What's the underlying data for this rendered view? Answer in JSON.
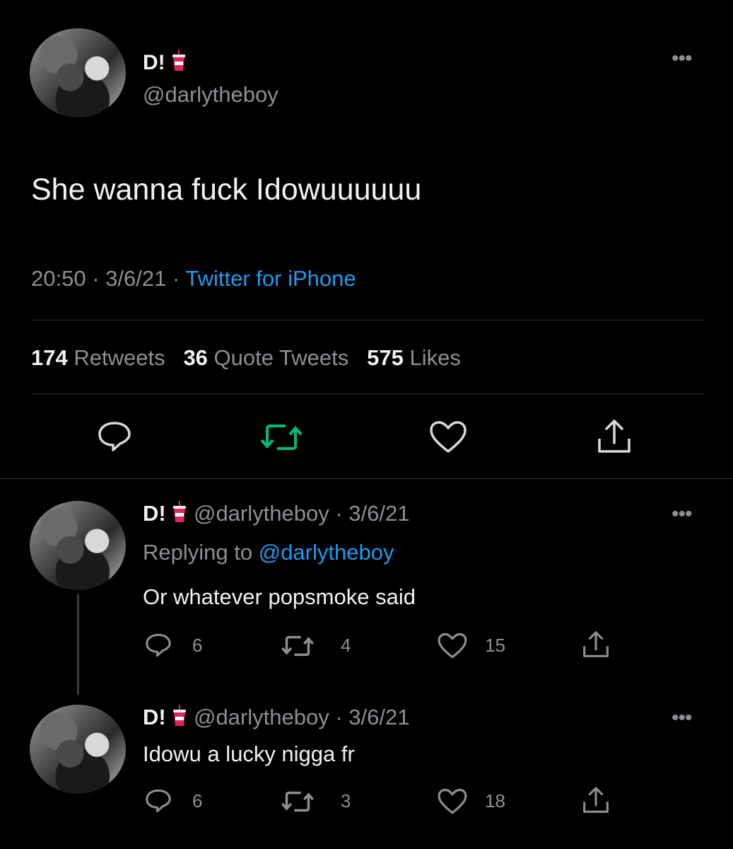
{
  "main_tweet": {
    "display_name": "D!",
    "handle": "@darlytheboy",
    "text": "She wanna fuck Idowuuuuuu",
    "time": "20:50",
    "date": "3/6/21",
    "sep": "·",
    "source": "Twitter for iPhone",
    "retweets_count": "174",
    "retweets_label": "Retweets",
    "quotes_count": "36",
    "quotes_label": "Quote Tweets",
    "likes_count": "575",
    "likes_label": "Likes"
  },
  "replies": [
    {
      "display_name": "D!",
      "meta": "@darlytheboy · 3/6/21",
      "replying_prefix": "Replying to",
      "replying_handle": "@darlytheboy",
      "text": "Or whatever popsmoke said",
      "reply_count": "6",
      "retweet_count": "4",
      "like_count": "15"
    },
    {
      "display_name": "D!",
      "meta": "@darlytheboy · 3/6/21",
      "text": "Idowu a lucky nigga fr",
      "reply_count": "6",
      "retweet_count": "3",
      "like_count": "18"
    }
  ],
  "colors": {
    "background": "#000000",
    "text": "#e7e9ea",
    "muted": "#8b8f94",
    "link": "#1d9bf0",
    "retweet_active": "#00ba7c",
    "cup_red": "#e0245e"
  },
  "icons": [
    "more-icon",
    "reply-icon",
    "retweet-icon",
    "like-icon",
    "share-icon",
    "cup-emoji-icon"
  ]
}
